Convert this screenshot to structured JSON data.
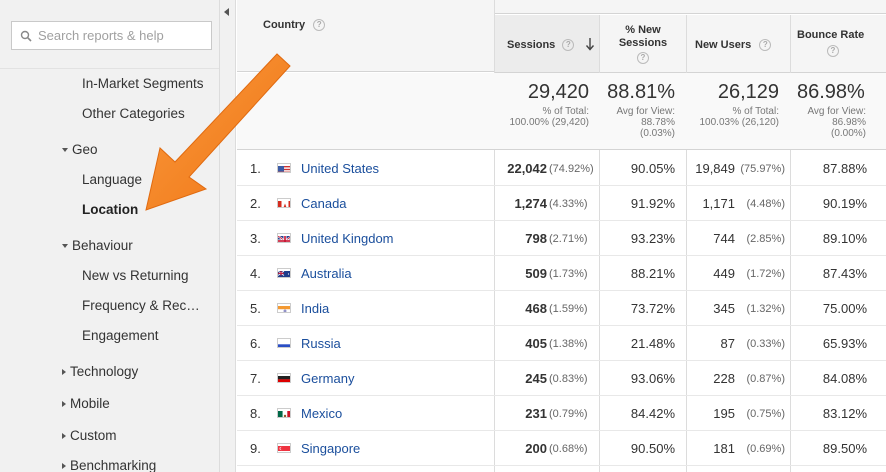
{
  "search": {
    "placeholder": "Search reports & help"
  },
  "sidebar": {
    "items": [
      {
        "label": "In-Market Segments",
        "type": "sub"
      },
      {
        "label": "Other Categories",
        "type": "sub"
      },
      {
        "label": "Geo",
        "type": "group-open"
      },
      {
        "label": "Language",
        "type": "sub"
      },
      {
        "label": "Location",
        "type": "sub-active"
      },
      {
        "label": "Behaviour",
        "type": "group-open"
      },
      {
        "label": "New vs Returning",
        "type": "sub"
      },
      {
        "label": "Frequency & Rec…",
        "type": "sub"
      },
      {
        "label": "Engagement",
        "type": "sub"
      },
      {
        "label": "Technology",
        "type": "group-closed"
      },
      {
        "label": "Mobile",
        "type": "group-closed"
      },
      {
        "label": "Custom",
        "type": "group-closed"
      },
      {
        "label": "Benchmarking",
        "type": "group-closed"
      }
    ]
  },
  "table": {
    "headers": {
      "country": "Country",
      "sessions": "Sessions",
      "new_sessions_1": "% New",
      "new_sessions_2": "Sessions",
      "new_users": "New Users",
      "bounce_rate": "Bounce Rate",
      "help": "?"
    },
    "totals": {
      "sessions": {
        "value": "29,420",
        "l1": "% of Total:",
        "l2": "100.00% (29,420)"
      },
      "new_sessions": {
        "value": "88.81%",
        "l1": "Avg for View:",
        "l2": "88.78%",
        "l3": "(0.03%)"
      },
      "new_users": {
        "value": "26,129",
        "l1": "% of Total:",
        "l2": "100.03% (26,120)"
      },
      "bounce_rate": {
        "value": "86.98%",
        "l1": "Avg for View:",
        "l2": "86.98%",
        "l3": "(0.00%)"
      }
    },
    "rows": [
      {
        "idx": "1.",
        "country": "United States",
        "flag": "us",
        "sessions": "22,042",
        "sessions_pct": "(74.92%)",
        "new_sessions": "90.05%",
        "new_users": "19,849",
        "new_users_pct": "(75.97%)",
        "bounce": "87.88%"
      },
      {
        "idx": "2.",
        "country": "Canada",
        "flag": "ca",
        "sessions": "1,274",
        "sessions_pct": "(4.33%)",
        "new_sessions": "91.92%",
        "new_users": "1,171",
        "new_users_pct": "(4.48%)",
        "bounce": "90.19%"
      },
      {
        "idx": "3.",
        "country": "United Kingdom",
        "flag": "gb",
        "sessions": "798",
        "sessions_pct": "(2.71%)",
        "new_sessions": "93.23%",
        "new_users": "744",
        "new_users_pct": "(2.85%)",
        "bounce": "89.10%"
      },
      {
        "idx": "4.",
        "country": "Australia",
        "flag": "au",
        "sessions": "509",
        "sessions_pct": "(1.73%)",
        "new_sessions": "88.21%",
        "new_users": "449",
        "new_users_pct": "(1.72%)",
        "bounce": "87.43%"
      },
      {
        "idx": "5.",
        "country": "India",
        "flag": "in",
        "sessions": "468",
        "sessions_pct": "(1.59%)",
        "new_sessions": "73.72%",
        "new_users": "345",
        "new_users_pct": "(1.32%)",
        "bounce": "75.00%"
      },
      {
        "idx": "6.",
        "country": "Russia",
        "flag": "ru",
        "sessions": "405",
        "sessions_pct": "(1.38%)",
        "new_sessions": "21.48%",
        "new_users": "87",
        "new_users_pct": "(0.33%)",
        "bounce": "65.93%"
      },
      {
        "idx": "7.",
        "country": "Germany",
        "flag": "de",
        "sessions": "245",
        "sessions_pct": "(0.83%)",
        "new_sessions": "93.06%",
        "new_users": "228",
        "new_users_pct": "(0.87%)",
        "bounce": "84.08%"
      },
      {
        "idx": "8.",
        "country": "Mexico",
        "flag": "mx",
        "sessions": "231",
        "sessions_pct": "(0.79%)",
        "new_sessions": "84.42%",
        "new_users": "195",
        "new_users_pct": "(0.75%)",
        "bounce": "83.12%"
      },
      {
        "idx": "9.",
        "country": "Singapore",
        "flag": "sg",
        "sessions": "200",
        "sessions_pct": "(0.68%)",
        "new_sessions": "90.50%",
        "new_users": "181",
        "new_users_pct": "(0.69%)",
        "bounce": "89.50%"
      }
    ]
  },
  "annotation": {
    "arrow_color": "#f4801f"
  },
  "colors": {
    "link": "#1a4e9c",
    "sidebar_bg": "#f1f1f1",
    "header_bg": "#f5f5f5"
  }
}
